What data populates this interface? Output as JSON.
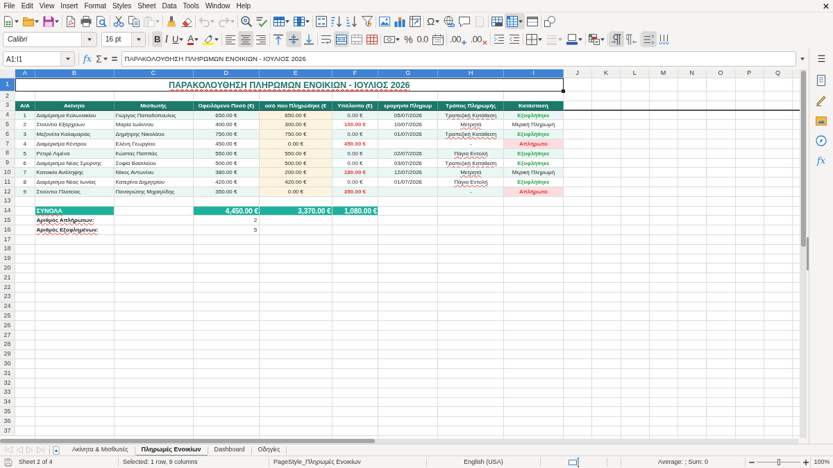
{
  "menu": [
    "File",
    "Edit",
    "View",
    "Insert",
    "Format",
    "Styles",
    "Sheet",
    "Data",
    "Tools",
    "Window",
    "Help"
  ],
  "standard_toolbar": [
    [
      {
        "pressed": false,
        "disabled": false,
        "dropdown": true
      },
      {
        "pressed": false,
        "disabled": false,
        "dropdown": true
      },
      {
        "pressed": false,
        "disabled": false,
        "dropdown": true
      }
    ],
    [
      {
        "pressed": false,
        "disabled": false,
        "dropdown": false
      },
      {
        "pressed": false,
        "disabled": false,
        "dropdown": false
      },
      {
        "pressed": false,
        "disabled": false,
        "dropdown": false
      }
    ],
    [
      {
        "pressed": false,
        "disabled": false,
        "dropdown": false
      },
      {
        "pressed": false,
        "disabled": false,
        "dropdown": false
      },
      {
        "pressed": false,
        "disabled": true,
        "dropdown": true
      }
    ],
    [
      {
        "pressed": false,
        "disabled": false,
        "dropdown": false
      },
      {
        "pressed": false,
        "disabled": false,
        "dropdown": false
      }
    ],
    [
      {
        "pressed": false,
        "disabled": true,
        "dropdown": true
      },
      {
        "pressed": false,
        "disabled": true,
        "dropdown": true
      }
    ],
    [
      {
        "pressed": false,
        "disabled": false,
        "dropdown": false
      },
      {
        "pressed": false,
        "disabled": false,
        "dropdown": false
      }
    ],
    [
      {
        "pressed": false,
        "disabled": false,
        "dropdown": true
      },
      {
        "pressed": false,
        "disabled": false,
        "dropdown": true
      }
    ],
    [
      {
        "pressed": false,
        "disabled": false,
        "dropdown": false
      },
      {
        "pressed": false,
        "disabled": false,
        "dropdown": false
      },
      {
        "pressed": false,
        "disabled": false,
        "dropdown": false
      },
      {
        "pressed": false,
        "disabled": false,
        "dropdown": false
      }
    ],
    [
      {
        "pressed": false,
        "disabled": false,
        "dropdown": false
      },
      {
        "pressed": false,
        "disabled": false,
        "dropdown": false
      },
      {
        "pressed": false,
        "disabled": false,
        "dropdown": false
      }
    ],
    [
      {
        "glyph": "Ω",
        "pressed": false,
        "disabled": false,
        "dropdown": true
      },
      {
        "pressed": false,
        "disabled": false,
        "dropdown": false
      },
      {
        "pressed": false,
        "disabled": false,
        "dropdown": false
      },
      {
        "pressed": false,
        "disabled": true,
        "dropdown": false
      }
    ],
    [
      {
        "pressed": false,
        "disabled": false,
        "dropdown": false
      },
      {
        "pressed": true,
        "disabled": false,
        "dropdown": true
      },
      {
        "pressed": false,
        "disabled": false,
        "dropdown": false
      }
    ],
    [
      {
        "pressed": false,
        "disabled": false,
        "dropdown": false
      }
    ]
  ],
  "formatting_toolbar": {
    "font_name": "Calibri",
    "font_size": "16 pt",
    "groups": [
      [
        {
          "glyph": "B",
          "pressed": true,
          "disabled": false,
          "dropdown": false
        },
        {
          "glyph": "I",
          "pressed": false,
          "disabled": false,
          "dropdown": false
        },
        {
          "glyph": "U",
          "pressed": false,
          "disabled": false,
          "dropdown": true
        },
        {
          "glyph": "A",
          "pressed": false,
          "disabled": false,
          "dropdown": true
        },
        {
          "pressed": false,
          "disabled": false,
          "dropdown": true
        }
      ],
      [
        {
          "pressed": false,
          "disabled": false,
          "dropdown": false
        },
        {
          "pressed": true,
          "disabled": false,
          "dropdown": false
        },
        {
          "pressed": false,
          "disabled": false,
          "dropdown": false
        }
      ],
      [
        {
          "pressed": false,
          "disabled": false,
          "dropdown": false
        },
        {
          "pressed": true,
          "disabled": false,
          "dropdown": false
        },
        {
          "pressed": false,
          "disabled": false,
          "dropdown": false
        }
      ],
      [
        {
          "pressed": false,
          "disabled": false,
          "dropdown": false
        },
        {
          "pressed": true,
          "disabled": false,
          "dropdown": false
        },
        {
          "pressed": false,
          "disabled": false,
          "dropdown": false
        },
        {
          "pressed": false,
          "disabled": false,
          "dropdown": false
        }
      ],
      [
        {
          "pressed": false,
          "disabled": false,
          "dropdown": true
        },
        {
          "glyph": "%",
          "pressed": false,
          "disabled": false,
          "dropdown": false
        },
        {
          "glyph": "0.0",
          "pressed": false,
          "disabled": false,
          "dropdown": false
        },
        {
          "pressed": false,
          "disabled": false,
          "dropdown": false
        }
      ],
      [
        {
          "glyph": ".00",
          "pressed": false,
          "disabled": false,
          "dropdown": false
        },
        {
          "glyph": ".00",
          "pressed": false,
          "disabled": false,
          "dropdown": false
        }
      ],
      [
        {
          "pressed": false,
          "disabled": false,
          "dropdown": false
        },
        {
          "pressed": false,
          "disabled": false,
          "dropdown": false
        }
      ],
      [
        {
          "pressed": false,
          "disabled": false,
          "dropdown": true
        },
        {
          "pressed": false,
          "disabled": true,
          "dropdown": true
        },
        {
          "pressed": false,
          "disabled": false,
          "dropdown": true
        }
      ],
      [
        {
          "pressed": false,
          "disabled": false,
          "dropdown": true
        }
      ],
      [
        {
          "pressed": true,
          "disabled": false,
          "dropdown": false
        },
        {
          "pressed": false,
          "disabled": false,
          "dropdown": false
        }
      ],
      [
        {
          "pressed": true,
          "disabled": false,
          "dropdown": false
        },
        {
          "pressed": false,
          "disabled": false,
          "dropdown": false
        }
      ]
    ]
  },
  "formula_bar": {
    "name_box": "A1:I1",
    "tools": [
      {
        "glyph": "fx",
        "dropdown": false
      },
      {
        "glyph": "Σ",
        "dropdown": true
      },
      {
        "glyph": "=",
        "dropdown": false
      }
    ],
    "input": "ΠΑΡΑΚΟΛΟΥΘΗΣΗ ΠΛΗΡΩΜΩΝ ΕΝΟΙΚΙΩΝ - ΙΟΥΛΙΟΣ 2026"
  },
  "sidebar": {
    "function_glyph": "fx"
  },
  "sheet": {
    "columns": [
      {
        "label": "A",
        "selected": true
      },
      {
        "label": "B",
        "selected": true
      },
      {
        "label": "C",
        "selected": true
      },
      {
        "label": "D",
        "selected": true
      },
      {
        "label": "E",
        "selected": true
      },
      {
        "label": "F",
        "selected": true
      },
      {
        "label": "G",
        "selected": true
      },
      {
        "label": "H",
        "selected": true
      },
      {
        "label": "I",
        "selected": true
      },
      {
        "label": "J",
        "selected": false
      },
      {
        "label": "K",
        "selected": false
      },
      {
        "label": "L",
        "selected": false
      },
      {
        "label": "M",
        "selected": false
      },
      {
        "label": "N",
        "selected": false
      },
      {
        "label": "O",
        "selected": false
      },
      {
        "label": "P",
        "selected": false
      },
      {
        "label": "Q",
        "selected": false
      }
    ],
    "rows": [
      {
        "label": "1",
        "selected": true
      },
      {
        "label": "2",
        "selected": false
      },
      {
        "label": "3",
        "selected": false
      },
      {
        "label": "4",
        "selected": false
      },
      {
        "label": "5",
        "selected": false
      },
      {
        "label": "6",
        "selected": false
      },
      {
        "label": "7",
        "selected": false
      },
      {
        "label": "8",
        "selected": false
      },
      {
        "label": "9",
        "selected": false
      },
      {
        "label": "10",
        "selected": false
      },
      {
        "label": "11",
        "selected": false
      },
      {
        "label": "12",
        "selected": false
      },
      {
        "label": "13",
        "selected": false
      },
      {
        "label": "14",
        "selected": false
      },
      {
        "label": "15",
        "selected": false
      },
      {
        "label": "16",
        "selected": false
      },
      {
        "label": "17",
        "selected": false
      },
      {
        "label": "18",
        "selected": false
      },
      {
        "label": "19",
        "selected": false
      },
      {
        "label": "20",
        "selected": false
      },
      {
        "label": "21",
        "selected": false
      },
      {
        "label": "22",
        "selected": false
      },
      {
        "label": "23",
        "selected": false
      },
      {
        "label": "24",
        "selected": false
      },
      {
        "label": "25",
        "selected": false
      },
      {
        "label": "26",
        "selected": false
      },
      {
        "label": "27",
        "selected": false
      },
      {
        "label": "28",
        "selected": false
      },
      {
        "label": "29",
        "selected": false
      },
      {
        "label": "30",
        "selected": false
      },
      {
        "label": "31",
        "selected": false
      },
      {
        "label": "32",
        "selected": false
      },
      {
        "label": "33",
        "selected": false
      },
      {
        "label": "34",
        "selected": false
      },
      {
        "label": "35",
        "selected": false
      },
      {
        "label": "36",
        "selected": false
      },
      {
        "label": "37",
        "selected": false
      }
    ],
    "title": {
      "text": "ΠΑΡΑΚΟΛΟΥΘΗΣΗ ΠΛΗΡΩΜΩΝ ΕΝΟΙΚΙΩΝ - ΙΟΥΛΙΟΣ 2026",
      "spell_flagged": true
    },
    "headers": [
      "Α/Α",
      "Ακίνητο",
      "Μισθωτής",
      "Οφειλόμενο Ποσό (€)",
      "οσό που Πληρώθηκε (€",
      "Υπόλοιπο (€)",
      "ερομηνία Πληρωμ",
      "Τρόπος Πληρωμής",
      "Κατάσταση"
    ],
    "records": [
      {
        "number": "1",
        "property": "Διαμέρισμα Κολωνακίου",
        "tenant": "Γιώργος Παπαδόπουλος",
        "owed": "650.00 €",
        "paid": "650.00 €",
        "balance": "0.00 €",
        "date": "05/07/2026",
        "method": "Τραπεζική Κατάθεση",
        "method_flagged": true,
        "status": "Εξοφλήθηκε",
        "kind": "paid"
      },
      {
        "number": "2",
        "property": "Στούντιο Εξαρχείων",
        "tenant": "Μαρία Ιωάννου",
        "owed": "400.00 €",
        "paid": "300.00 €",
        "balance": "100.00 €",
        "date": "10/07/2026",
        "method": "Μετρητά",
        "method_flagged": true,
        "status": "Μερική Πληρωμή",
        "kind": "partial"
      },
      {
        "number": "3",
        "property": "Μεζονέτα Καλαμαριάς",
        "tenant": "Δημήτρης Νικολάου",
        "owed": "750.00 €",
        "paid": "750.00 €",
        "balance": "0.00 €",
        "date": "01/07/2026",
        "method": "Τραπεζική Κατάθεση",
        "method_flagged": true,
        "status": "Εξοφλήθηκε",
        "kind": "paid"
      },
      {
        "number": "4",
        "property": "Διαμέρισμα Κέντρου",
        "tenant": "Ελένη Γεωργίου",
        "owed": "450.00 €",
        "paid": "0.00 €",
        "balance": "450.00 €",
        "method": "-",
        "method_flagged": false,
        "status": "Απλήρωτο",
        "kind": "unpaid"
      },
      {
        "number": "5",
        "property": "Ρετιρέ Λιμένα",
        "tenant": "Κώστας Παππάς",
        "owed": "550.00 €",
        "paid": "550.00 €",
        "balance": "0.00 €",
        "date": "02/07/2026",
        "method": "Πάγια Εντολή",
        "method_flagged": true,
        "status": "Εξοφλήθηκε",
        "kind": "paid"
      },
      {
        "number": "6",
        "property": "Διαμέρισμα Νέας Σμύρνης",
        "tenant": "Σοφία Βασιλείου",
        "owed": "500.00 €",
        "paid": "500.00 €",
        "balance": "0.00 €",
        "date": "03/07/2026",
        "method": "Τραπεζική Κατάθεση",
        "method_flagged": true,
        "status": "Εξοφλήθηκε",
        "kind": "paid"
      },
      {
        "number": "7",
        "property": "Κατοικία Ανάληψης",
        "tenant": "Νίκος Αντωνίου",
        "owed": "380.00 €",
        "paid": "200.00 €",
        "balance": "180.00 €",
        "date": "12/07/2026",
        "method": "Μετρητά",
        "method_flagged": true,
        "status": "Μερική Πληρωμή",
        "kind": "partial"
      },
      {
        "number": "8",
        "property": "Διαμέρισμα Νέας Ιωνίας",
        "tenant": "Κατερίνα Δημητρίου",
        "owed": "420.00 €",
        "paid": "420.00 €",
        "balance": "0.00 €",
        "date": "01/07/2026",
        "method": "Πάγια Εντολή",
        "method_flagged": true,
        "status": "Εξοφλήθηκε",
        "kind": "paid"
      },
      {
        "number": "9",
        "property": "Στούντιο Πλατείας",
        "tenant": "Παναγιώτης Μιχαηλίδης",
        "owed": "350.00 €",
        "paid": "0.00 €",
        "balance": "350.00 €",
        "method": "-",
        "method_flagged": false,
        "status": "Απλήρωτο",
        "kind": "unpaid"
      }
    ],
    "totals": {
      "label": "ΣΥΝΟΛΑ",
      "label_flagged": true,
      "owed": "4,450.00 €",
      "paid": "3,370.00 €",
      "balance": "1,080.00 €"
    },
    "summary": [
      {
        "label": "Αριθμός Απλήρωτων:",
        "value": "2",
        "spell_flagged": true
      },
      {
        "label": "Αριθμός Εξοφλημένων:",
        "value": "5",
        "spell_flagged": true
      }
    ]
  },
  "sheet_navigation": [
    {
      "disabled": true
    },
    {
      "disabled": true
    },
    {
      "disabled": true
    },
    {
      "disabled": true
    }
  ],
  "sheet_tabs": [
    {
      "label": "Ακίνητα & Μισθωτές",
      "selected": false
    },
    {
      "label": "Πληρωμές Ενοικίων",
      "selected": true
    },
    {
      "label": "Dashboard",
      "selected": false
    },
    {
      "label": "Οδηγίες",
      "selected": false
    }
  ],
  "status_bar": {
    "sheet": "Sheet 2 of 4",
    "selection": "Selected: 1 row, 9 columns",
    "page_style": "PageStyle_Πληρωμές Ενοικίων",
    "language": "English (USA)",
    "statistics": "Average: ; Sum: 0",
    "zoom": {
      "level": 0.5,
      "reading": "100%"
    }
  }
}
